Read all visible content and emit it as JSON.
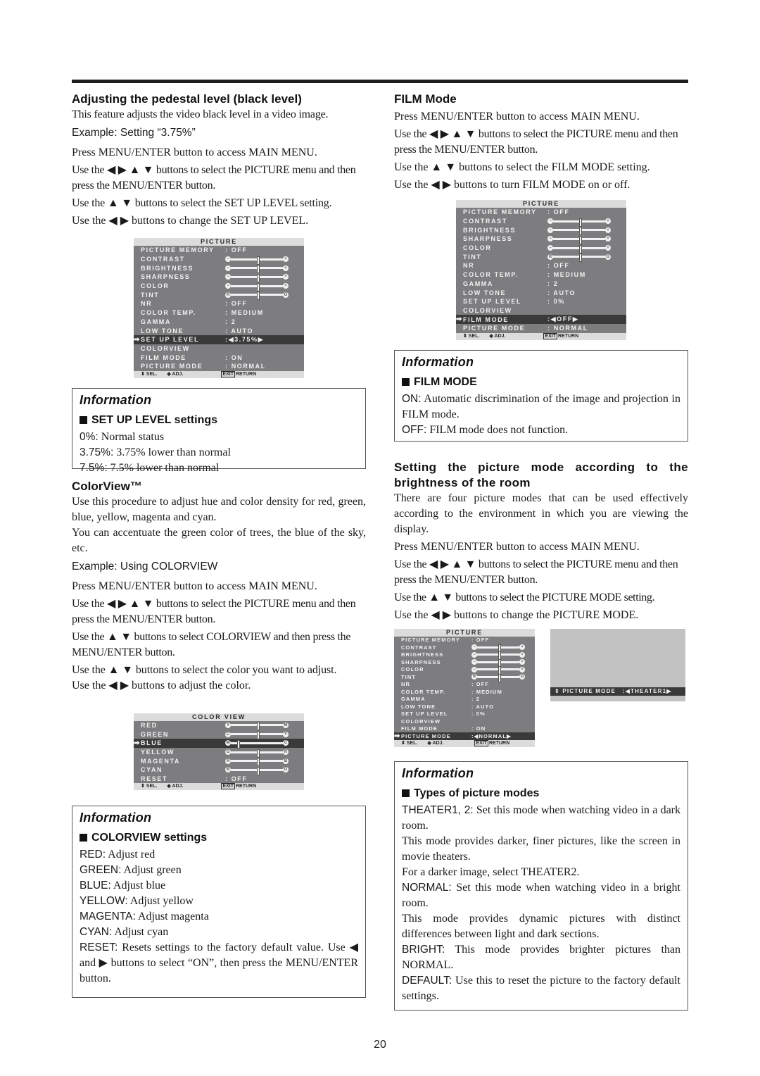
{
  "page_number": "20",
  "left": {
    "pedestal": {
      "heading": "Adjusting the pedestal level (black level)",
      "intro": "This feature adjusts the video black level in a video image.",
      "example": "Example: Setting “3.75%”",
      "steps": [
        "Press MENU/ENTER button to access MAIN MENU.",
        "Use the ◀ ▶ ▲ ▼ buttons to select the PICTURE menu and then press the MENU/ENTER button.",
        "Use the ▲ ▼ buttons to select the SET UP LEVEL setting.",
        "Use the ◀ ▶ buttons to change the SET UP LEVEL."
      ]
    },
    "setup_info": {
      "heading": "Information",
      "subheading": "SET UP LEVEL settings",
      "items": [
        {
          "label": "0%:",
          "text": " Normal status"
        },
        {
          "label": "3.75%:",
          "text": " 3.75% lower than normal"
        },
        {
          "label": "7.5%:",
          "text": " 7.5% lower than normal"
        }
      ]
    },
    "colorview": {
      "heading": "ColorView™",
      "intro1": "Use this procedure to adjust hue and color density for red, green, blue, yellow, magenta and cyan.",
      "intro2": "You can accentuate the green color of trees, the blue of the sky, etc.",
      "example": "Example: Using COLORVIEW",
      "steps": [
        "Press MENU/ENTER button to access MAIN MENU.",
        "Use the ◀ ▶ ▲ ▼ buttons to select the PICTURE menu and then press the MENU/ENTER button.",
        "Use the ▲ ▼ buttons to select COLORVIEW and then press the MENU/ENTER button.",
        "Use the ▲ ▼ buttons to select the color you want to adjust.",
        "Use the ◀ ▶ buttons to adjust the color."
      ]
    },
    "colorview_info": {
      "heading": "Information",
      "subheading": "COLORVIEW settings",
      "items": [
        {
          "label": "RED:",
          "text": " Adjust red"
        },
        {
          "label": "GREEN:",
          "text": " Adjust green"
        },
        {
          "label": "BLUE:",
          "text": "  Adjust blue"
        },
        {
          "label": "YELLOW:",
          "text": " Adjust yellow"
        },
        {
          "label": "MAGENTA:",
          "text": " Adjust magenta"
        },
        {
          "label": "CYAN:",
          "text": " Adjust cyan"
        },
        {
          "label": "RESET:",
          "text": " Resets settings to the factory default value. Use  ◀ and ▶ buttons to select “ON”, then press the MENU/ENTER button."
        }
      ]
    }
  },
  "right": {
    "film": {
      "heading": "FILM Mode",
      "steps": [
        "Press MENU/ENTER button to access MAIN MENU.",
        "Use the ◀ ▶ ▲ ▼ buttons to select the PICTURE menu and then press the MENU/ENTER button.",
        "Use the ▲ ▼ buttons to select the FILM MODE setting.",
        "Use the ◀ ▶ buttons to turn FILM MODE on or off."
      ]
    },
    "film_info": {
      "heading": "Information",
      "subheading": "FILM MODE",
      "items": [
        {
          "label": "ON:",
          "text": " Automatic discrimination of the image and projection in FILM mode."
        },
        {
          "label": "OFF:",
          "text": " FILM mode does not function."
        }
      ]
    },
    "picmode": {
      "heading": "Setting the picture mode according to the brightness of the room",
      "intro": "There are four picture modes that can be used effectively according to the environment in which you are viewing the display.",
      "steps": [
        "Press MENU/ENTER button to access MAIN MENU.",
        "Use the ◀ ▶ ▲ ▼ buttons to select the PICTURE menu and then press the MENU/ENTER button.",
        "Use the ▲ ▼ buttons to select the PICTURE MODE setting.",
        "Use the ◀ ▶ buttons to change the PICTURE MODE."
      ],
      "screen_bar": {
        "name": "PICTURE MODE",
        "value": ":◀THEATER1▶"
      }
    },
    "picmode_info": {
      "heading": "Information",
      "subheading": "Types of picture modes",
      "items": [
        {
          "label": "THEATER1, 2:",
          "text": " Set this mode when watching video in a dark room."
        },
        {
          "label": "",
          "text": "This mode provides darker, finer pictures, like the screen in movie theaters."
        },
        {
          "label": "",
          "text": "For a darker image, select THEATER2."
        },
        {
          "label": "NORMAL:",
          "text": " Set this mode when watching video in a bright room."
        },
        {
          "label": "",
          "text": "This mode provides dynamic pictures with distinct differences between light and dark sections."
        },
        {
          "label": "BRIGHT:",
          "text": " This mode provides brighter pictures than NORMAL."
        },
        {
          "label": "DEFAULT:",
          "text": " Use this to reset the picture to the factory default settings."
        }
      ]
    }
  },
  "osd": {
    "footer": {
      "sel": "SEL.",
      "adj": "ADJ.",
      "exit": "EXIT",
      "return": "RETURN"
    },
    "picture_setup": {
      "title": "PICTURE",
      "rows": [
        {
          "name": "PICTURE MEMORY",
          "value": ":  OFF"
        },
        {
          "name": "CONTRAST",
          "slider": [
            "−",
            "+"
          ],
          "level": 0.5
        },
        {
          "name": "BRIGHTNESS",
          "slider": [
            "−",
            "+"
          ],
          "level": 0.5
        },
        {
          "name": "SHARPNESS",
          "slider": [
            "−",
            "+"
          ],
          "level": 0.5
        },
        {
          "name": "COLOR",
          "slider": [
            "−",
            "+"
          ],
          "level": 0.5
        },
        {
          "name": "TINT",
          "slider": [
            "R",
            "G"
          ],
          "level": 0.5
        },
        {
          "name": "NR",
          "value": ":  OFF"
        },
        {
          "name": "COLOR TEMP.",
          "value": ":  MEDIUM"
        },
        {
          "name": "GAMMA",
          "value": ":  2"
        },
        {
          "name": "LOW TONE",
          "value": ":  AUTO"
        },
        {
          "name": "SET UP LEVEL",
          "value": ":◀3.75%▶",
          "selected": true
        },
        {
          "name": "COLORVIEW",
          "value": ""
        },
        {
          "name": "FILM MODE",
          "value": ":  ON"
        },
        {
          "name": "PICTURE MODE",
          "value": ":  NORMAL"
        }
      ]
    },
    "picture_film": {
      "title": "PICTURE",
      "rows": [
        {
          "name": "PICTURE MEMORY",
          "value": ":  OFF"
        },
        {
          "name": "CONTRAST",
          "slider": [
            "−",
            "+"
          ],
          "level": 0.5
        },
        {
          "name": "BRIGHTNESS",
          "slider": [
            "−",
            "+"
          ],
          "level": 0.5
        },
        {
          "name": "SHARPNESS",
          "slider": [
            "−",
            "+"
          ],
          "level": 0.5
        },
        {
          "name": "COLOR",
          "slider": [
            "−",
            "+"
          ],
          "level": 0.5
        },
        {
          "name": "TINT",
          "slider": [
            "R",
            "G"
          ],
          "level": 0.5
        },
        {
          "name": "NR",
          "value": ":  OFF"
        },
        {
          "name": "COLOR TEMP.",
          "value": ":  MEDIUM"
        },
        {
          "name": "GAMMA",
          "value": ":  2"
        },
        {
          "name": "LOW TONE",
          "value": ":  AUTO"
        },
        {
          "name": "SET UP LEVEL",
          "value": ":  0%"
        },
        {
          "name": "COLORVIEW",
          "value": ""
        },
        {
          "name": "FILM MODE",
          "value": ":◀OFF▶",
          "selected": true
        },
        {
          "name": "PICTURE MODE",
          "value": ":  NORMAL"
        }
      ]
    },
    "picture_mode": {
      "title": "PICTURE",
      "rows": [
        {
          "name": "PICTURE MEMORY",
          "value": ":  OFF"
        },
        {
          "name": "CONTRAST",
          "slider": [
            "−",
            "+"
          ],
          "level": 0.5
        },
        {
          "name": "BRIGHTNESS",
          "slider": [
            "−",
            "+"
          ],
          "level": 0.5
        },
        {
          "name": "SHARPNESS",
          "slider": [
            "−",
            "+"
          ],
          "level": 0.5
        },
        {
          "name": "COLOR",
          "slider": [
            "−",
            "+"
          ],
          "level": 0.5
        },
        {
          "name": "TINT",
          "slider": [
            "R",
            "G"
          ],
          "level": 0.5
        },
        {
          "name": "NR",
          "value": ":  OFF"
        },
        {
          "name": "COLOR TEMP.",
          "value": ":  MEDIUM"
        },
        {
          "name": "GAMMA",
          "value": ":  2"
        },
        {
          "name": "LOW TONE",
          "value": ":  AUTO"
        },
        {
          "name": "SET UP LEVEL",
          "value": ":  0%"
        },
        {
          "name": "COLORVIEW",
          "value": ""
        },
        {
          "name": "FILM MODE",
          "value": ":  ON"
        },
        {
          "name": "PICTURE MODE",
          "value": ":◀NORMAL▶",
          "selected": true
        }
      ]
    },
    "colorview": {
      "title": "COLOR VIEW",
      "rows": [
        {
          "name": "RED",
          "slider": [
            "Y",
            "M"
          ],
          "level": 0.5
        },
        {
          "name": "GREEN",
          "slider": [
            "C",
            "Y"
          ],
          "level": 0.5
        },
        {
          "name": "BLUE",
          "slider": [
            "M",
            "C"
          ],
          "level": 0.12,
          "selected": true
        },
        {
          "name": "YELLOW",
          "slider": [
            "G",
            "R"
          ],
          "level": 0.5
        },
        {
          "name": "MAGENTA",
          "slider": [
            "R",
            "B"
          ],
          "level": 0.5
        },
        {
          "name": "CYAN",
          "slider": [
            "B",
            "G"
          ],
          "level": 0.5
        },
        {
          "name": "RESET",
          "value": ":  OFF"
        }
      ]
    }
  }
}
